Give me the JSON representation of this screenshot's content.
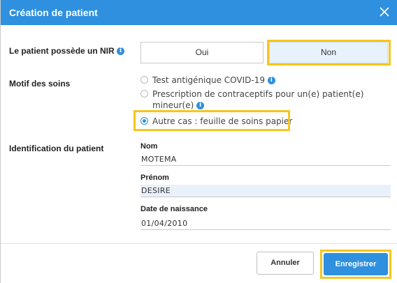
{
  "dialog": {
    "title": "Création de patient"
  },
  "nir": {
    "label": "Le patient possède un NIR",
    "options": [
      "Oui",
      "Non"
    ],
    "selected": "Non"
  },
  "motif": {
    "label": "Motif des soins",
    "options": [
      {
        "text": "Test antigénique COVID-19",
        "checked": false
      },
      {
        "text": "Prescription de contraceptifs pour un(e) patient(e) mineur(e)",
        "checked": false
      },
      {
        "text": "Autre cas : feuille de soins papier",
        "checked": true
      }
    ]
  },
  "identification": {
    "label": "Identification du patient",
    "nom_label": "Nom",
    "nom_value": "MOTEMA",
    "prenom_label": "Prénom",
    "prenom_value": "DESIRE",
    "naissance_label": "Date de naissance",
    "naissance_value": "01/04/2010"
  },
  "footer": {
    "cancel_label": "Annuler",
    "save_label": "Enregistrer"
  },
  "colors": {
    "accent": "#2e90de",
    "highlight": "#f5c61f"
  }
}
